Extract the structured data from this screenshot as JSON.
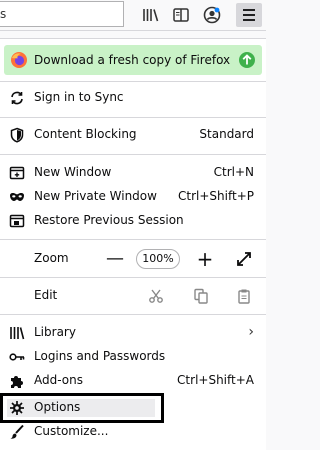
{
  "toolbar": {
    "url_letter": "s",
    "icons": [
      "library-icon",
      "reader-view-icon",
      "account-icon",
      "menu-icon"
    ]
  },
  "banner": {
    "label": "Download a fresh copy of Firefox",
    "color": "#c9f2c7",
    "accent": "#3fb14c"
  },
  "menu": {
    "sync": "Sign in to Sync",
    "content_blocking": "Content Blocking",
    "content_blocking_value": "Standard",
    "new_window": "New Window",
    "new_window_key": "Ctrl+N",
    "new_private": "New Private Window",
    "new_private_key": "Ctrl+Shift+P",
    "restore": "Restore Previous Session",
    "zoom": "Zoom",
    "zoom_minus": "—",
    "zoom_value": "100%",
    "zoom_plus": "+",
    "edit": "Edit",
    "library": "Library",
    "library_chevron": "›",
    "logins": "Logins and Passwords",
    "addons": "Add-ons",
    "addons_key": "Ctrl+Shift+A",
    "options": "Options",
    "customize": "Customize..."
  }
}
